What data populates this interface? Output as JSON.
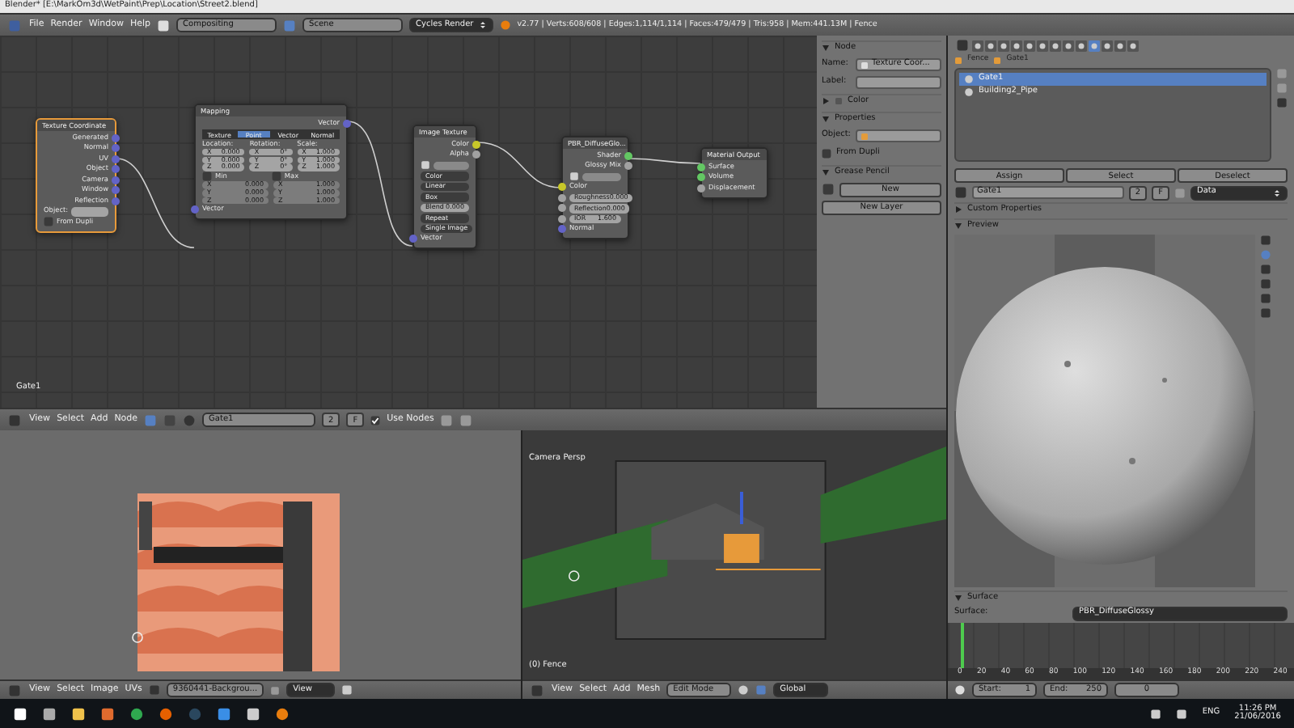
{
  "window": {
    "title": "Blender* [E:\\MarkOm3d\\WetPaint\\Prep\\Location\\Street2.blend]"
  },
  "info_header": {
    "menus": [
      "File",
      "Render",
      "Window",
      "Help"
    ],
    "layout": "Compositing",
    "scene": "Scene",
    "engine": "Cycles Render",
    "stats": "v2.77 | Verts:608/608 | Edges:1,114/1,114 | Faces:479/479 | Tris:958 | Mem:441.13M | Fence"
  },
  "node_editor": {
    "material_label": "Gate1",
    "nodes": [
      {
        "title": "Texture Coordinate",
        "selected": true,
        "rows": [
          {
            "kind": "output",
            "label": "Generated",
            "color": "#6363c7"
          },
          {
            "kind": "output",
            "label": "Normal",
            "color": "#6363c7"
          },
          {
            "kind": "output",
            "label": "UV",
            "color": "#6363c7"
          },
          {
            "kind": "output",
            "label": "Object",
            "color": "#6363c7"
          },
          {
            "kind": "output",
            "label": "Camera",
            "color": "#6363c7"
          },
          {
            "kind": "output",
            "label": "Window",
            "color": "#6363c7"
          },
          {
            "kind": "output",
            "label": "Reflection",
            "color": "#6363c7"
          },
          {
            "kind": "field",
            "label": "Object:"
          },
          {
            "kind": "check",
            "label": "From Dupli",
            "checked": false
          }
        ]
      },
      {
        "title": "Mapping",
        "selected": false,
        "rows": [
          {
            "kind": "output",
            "label": "Vector",
            "color": "#6363c7"
          },
          {
            "kind": "tabs",
            "items": [
              {
                "label": "Texture",
                "selected": false
              },
              {
                "label": "Point",
                "selected": true
              },
              {
                "label": "Vector",
                "selected": false
              },
              {
                "label": "Normal",
                "selected": false
              }
            ]
          },
          {
            "kind": "grid",
            "disabled": false,
            "columns": [
              {
                "heading": "Location:",
                "cells": [
                  {
                    "axis": "X",
                    "value": "0.000"
                  },
                  {
                    "axis": "Y",
                    "value": "0.000"
                  },
                  {
                    "axis": "Z",
                    "value": "0.000"
                  }
                ]
              },
              {
                "heading": "Rotation:",
                "cells": [
                  {
                    "axis": "X",
                    "value": "0°"
                  },
                  {
                    "axis": "Y",
                    "value": "0°"
                  },
                  {
                    "axis": "Z",
                    "value": "0°"
                  }
                ]
              },
              {
                "heading": "Scale:",
                "cells": [
                  {
                    "axis": "X",
                    "value": "1.000"
                  },
                  {
                    "axis": "Y",
                    "value": "1.000"
                  },
                  {
                    "axis": "Z",
                    "value": "1.000"
                  }
                ]
              }
            ]
          },
          {
            "kind": "checks",
            "items": [
              {
                "label": "Min",
                "checked": false
              },
              {
                "label": "Max",
                "checked": false
              }
            ]
          },
          {
            "kind": "grid",
            "disabled": true,
            "columns": [
              {
                "cells": [
                  {
                    "axis": "X",
                    "value": "0.000"
                  },
                  {
                    "axis": "Y",
                    "value": "0.000"
                  },
                  {
                    "axis": "Z",
                    "value": "0.000"
                  }
                ]
              },
              {
                "cells": [
                  {
                    "axis": "X",
                    "value": "1.000"
                  },
                  {
                    "axis": "Y",
                    "value": "1.000"
                  },
                  {
                    "axis": "Z",
                    "value": "1.000"
                  }
                ]
              }
            ]
          },
          {
            "kind": "input",
            "label": "Vector",
            "color": "#6363c7"
          }
        ]
      },
      {
        "title": "Image Texture",
        "selected": false,
        "rows": [
          {
            "kind": "output",
            "label": "Color",
            "color": "#c7c729"
          },
          {
            "kind": "output",
            "label": "Alpha",
            "color": "#a1a1a1"
          },
          {
            "kind": "image_select"
          },
          {
            "kind": "dropdown",
            "label": "Color"
          },
          {
            "kind": "dropdown",
            "label": "Linear"
          },
          {
            "kind": "dropdown",
            "label": "Box"
          },
          {
            "kind": "value",
            "label": "Blend",
            "value": "0.000"
          },
          {
            "kind": "dropdown",
            "label": "Repeat"
          },
          {
            "kind": "dropdown",
            "label": "Single Image"
          },
          {
            "kind": "input",
            "label": "Vector",
            "color": "#6363c7"
          }
        ]
      },
      {
        "title": "PBR_DiffuseGlo...",
        "selected": false,
        "rows": [
          {
            "kind": "output",
            "label": "Shader",
            "color": "#63c763"
          },
          {
            "kind": "output",
            "label": "Glossy Mix",
            "color": "#a1a1a1"
          },
          {
            "kind": "image_select"
          },
          {
            "kind": "input",
            "label": "Color",
            "color": "#c7c729"
          },
          {
            "kind": "input_field",
            "label": "Roughness",
            "value": "0.000",
            "color": "#a1a1a1"
          },
          {
            "kind": "input_field",
            "label": "Reflection",
            "value": "0.000",
            "color": "#a1a1a1"
          },
          {
            "kind": "input_field",
            "label": "IOR",
            "value": "1.600",
            "color": "#a1a1a1"
          },
          {
            "kind": "input",
            "label": "Normal",
            "color": "#6363c7"
          }
        ]
      },
      {
        "title": "Material Output",
        "selected": false,
        "rows": [
          {
            "kind": "input",
            "label": "Surface",
            "color": "#63c763"
          },
          {
            "kind": "input",
            "label": "Volume",
            "color": "#63c763"
          },
          {
            "kind": "input",
            "label": "Displacement",
            "color": "#a1a1a1"
          }
        ]
      }
    ]
  },
  "node_panel": {
    "node": {
      "heading": "Node",
      "expanded": true,
      "name_label": "Name:",
      "name": "Texture Coor...",
      "label_label": "Label:"
    },
    "color": {
      "heading": "Color",
      "expanded": false
    },
    "properties": {
      "heading": "Properties",
      "expanded": true,
      "object_label": "Object:",
      "from_dupli": {
        "label": "From Dupli",
        "checked": false
      }
    },
    "grease_pencil": {
      "heading": "Grease Pencil",
      "expanded": true,
      "new": "New",
      "new_layer": "New Layer"
    }
  },
  "node_header": {
    "menus": [
      "View",
      "Select",
      "Add",
      "Node"
    ],
    "material": "Gate1",
    "users": "2",
    "fake_user": "F",
    "use_nodes": {
      "label": "Use Nodes",
      "checked": true
    }
  },
  "image_editor": {
    "header": {
      "menus": [
        "View",
        "Select",
        "Image",
        "UVs"
      ],
      "image": "9360441-Backgrou...",
      "view": "View"
    }
  },
  "viewport": {
    "overlay_title": "Camera Persp",
    "object_label": "(0) Fence",
    "header": {
      "menus": [
        "View",
        "Select",
        "Add",
        "Mesh"
      ],
      "mode": "Edit Mode",
      "orientation": "Global"
    }
  },
  "properties": {
    "context_tabs": [
      {
        "selected": false
      },
      {
        "selected": false
      },
      {
        "selected": false
      },
      {
        "selected": false
      },
      {
        "selected": false
      },
      {
        "selected": false
      },
      {
        "selected": false
      },
      {
        "selected": false
      },
      {
        "selected": false
      },
      {
        "selected": true
      },
      {
        "selected": false
      },
      {
        "selected": false
      },
      {
        "selected": false
      }
    ],
    "breadcrumb": [
      "Fence",
      "Gate1"
    ],
    "slots": [
      {
        "name": "Gate1",
        "selected": true
      },
      {
        "name": "Building2_Pipe",
        "selected": false
      }
    ],
    "slot_buttons": [
      "Assign",
      "Select",
      "Deselect"
    ],
    "material": "Gate1",
    "users": "2",
    "fake_user": "F",
    "link": "Data",
    "panels": [
      {
        "label": "Custom Properties",
        "expanded": false
      },
      {
        "label": "Preview",
        "expanded": true
      }
    ],
    "surface": {
      "heading": "Surface",
      "expanded": true,
      "label": "Surface:",
      "shader": "PBR_DiffuseGlossy"
    }
  },
  "timeline": {
    "ticks": [
      "0",
      "20",
      "40",
      "60",
      "80",
      "100",
      "120",
      "140",
      "160",
      "180",
      "200",
      "220",
      "240"
    ],
    "start": "Start:",
    "start_value": "1",
    "end": "End:",
    "end_value": "250",
    "frame": "0"
  },
  "taskbar": {
    "language": "ENG",
    "time": "11:26 PM",
    "date": "21/06/2016"
  }
}
